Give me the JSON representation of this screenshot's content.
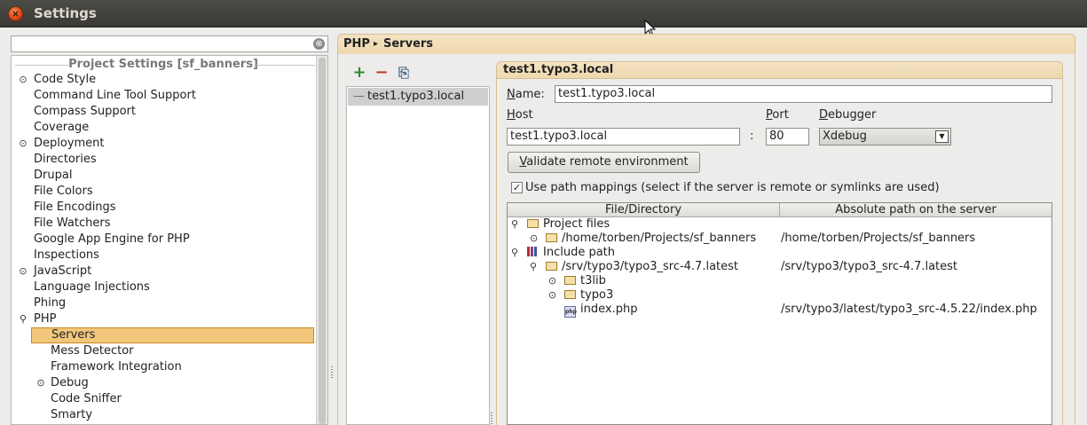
{
  "window": {
    "title": "Settings",
    "close_glyph": "×"
  },
  "left": {
    "search_value": "",
    "clear_glyph": "⊗",
    "section_title": "Project Settings [sf_banners]",
    "items": [
      {
        "label": "Code Style",
        "toggle": "collapsed"
      },
      {
        "label": "Command Line Tool Support"
      },
      {
        "label": "Compass Support"
      },
      {
        "label": "Coverage"
      },
      {
        "label": "Deployment",
        "toggle": "collapsed"
      },
      {
        "label": "Directories"
      },
      {
        "label": "Drupal"
      },
      {
        "label": "File Colors"
      },
      {
        "label": "File Encodings"
      },
      {
        "label": "File Watchers"
      },
      {
        "label": "Google App Engine for PHP"
      },
      {
        "label": "Inspections"
      },
      {
        "label": "JavaScript",
        "toggle": "collapsed"
      },
      {
        "label": "Language Injections"
      },
      {
        "label": "Phing"
      },
      {
        "label": "PHP",
        "toggle": "expanded"
      },
      {
        "label": "Servers",
        "selected": true
      },
      {
        "label": "Mess Detector"
      },
      {
        "label": "Framework Integration"
      },
      {
        "label": "Debug",
        "toggle": "collapsed"
      },
      {
        "label": "Code Sniffer"
      },
      {
        "label": "Smarty"
      }
    ]
  },
  "breadcrumb": {
    "parent": "PHP",
    "separator": "▸",
    "current": "Servers"
  },
  "toolbar": {
    "add_glyph": "+",
    "remove_glyph": "−",
    "copy_glyph": "⎘",
    "add_color": "#2e8b2e",
    "remove_color": "#c0392b"
  },
  "servers": {
    "items": [
      "test1.typo3.local"
    ],
    "item_prefix": "—"
  },
  "detail": {
    "header": "test1.typo3.local",
    "name_label_u": "N",
    "name_label_rest": "ame:",
    "name_value": "test1.typo3.local",
    "host_label_u": "H",
    "host_label_rest": "ost",
    "host_value": "test1.typo3.local",
    "port_label_u": "P",
    "port_label_rest": "ort",
    "port_value": "80",
    "colon": ":",
    "debugger_label_u": "D",
    "debugger_label_rest": "ebugger",
    "debugger_value": "Xdebug",
    "validate_u": "V",
    "validate_rest": "alidate remote environment",
    "mappings_checked": true,
    "mappings_label": "Use path mappings (select if the server is remote or symlinks are used)"
  },
  "table": {
    "col1": "File/Directory",
    "col2": "Absolute path on the server",
    "rows": [
      {
        "name": "Project files",
        "icon": "folder",
        "toggle": "expanded",
        "indent": 0,
        "path": ""
      },
      {
        "name": "/home/torben/Projects/sf_banners",
        "icon": "folder",
        "toggle": "collapsed",
        "indent": 1,
        "path": "/home/torben/Projects/sf_banners"
      },
      {
        "name": "Include path",
        "icon": "library",
        "toggle": "expanded",
        "indent": 0,
        "path": ""
      },
      {
        "name": "/srv/typo3/typo3_src-4.7.latest",
        "icon": "folder",
        "toggle": "expanded",
        "indent": 1,
        "path": "/srv/typo3/typo3_src-4.7.latest"
      },
      {
        "name": "t3lib",
        "icon": "folder",
        "toggle": "collapsed",
        "indent": 2,
        "path": ""
      },
      {
        "name": "typo3",
        "icon": "folder",
        "toggle": "collapsed",
        "indent": 2,
        "path": ""
      },
      {
        "name": "index.php",
        "icon": "php",
        "toggle": "",
        "indent": 2,
        "path": "/srv/typo3/latest/typo3_src-4.5.22/index.php"
      }
    ]
  },
  "glyphs": {
    "collapsed": "⊙",
    "expanded": "⚲",
    "php_icon_text": "php",
    "check": "✓",
    "combo_arrow": "▼"
  }
}
